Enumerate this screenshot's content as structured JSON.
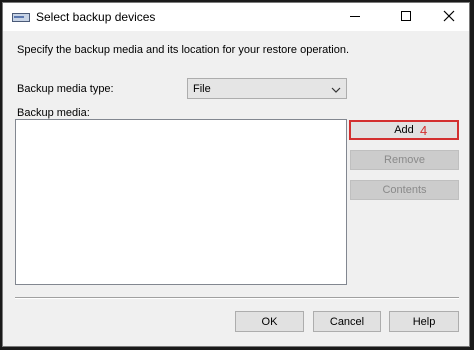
{
  "window": {
    "title": "Select backup devices",
    "app_icon": "backup-device-icon",
    "controls": {
      "minimize_icon": "minimize-icon",
      "maximize_icon": "maximize-icon",
      "close_icon": "close-icon"
    }
  },
  "dialog": {
    "instruction": "Specify the backup media and its location for your restore operation.",
    "media_type_label": "Backup media type:",
    "media_type_value": "File",
    "media_list_label": "Backup media:",
    "media_items": []
  },
  "side_buttons": {
    "add_label": "Add",
    "add_annotation": "4",
    "remove_label": "Remove",
    "contents_label": "Contents"
  },
  "footer_buttons": {
    "ok_label": "OK",
    "cancel_label": "Cancel",
    "help_label": "Help"
  },
  "colors": {
    "annotation": "#d32f2f",
    "dialog_bg": "#f0f0f0",
    "titlebar_bg": "#ffffff"
  }
}
